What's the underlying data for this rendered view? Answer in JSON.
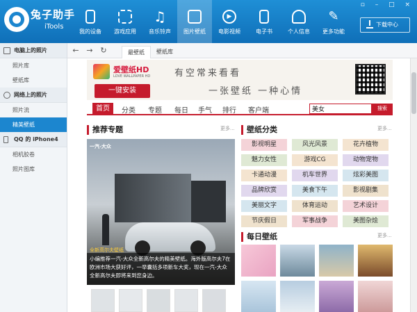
{
  "app": {
    "title_cn": "兔子助手",
    "title_en": "iTools"
  },
  "window_controls": "▫ – □ ×",
  "nav": [
    {
      "label": "我的设备",
      "icon": "phone-icon"
    },
    {
      "label": "游戏应用",
      "icon": "apps-icon"
    },
    {
      "label": "音乐铃声",
      "icon": "music-icon"
    },
    {
      "label": "图片壁纸",
      "icon": "image-icon",
      "active": true
    },
    {
      "label": "电影视频",
      "icon": "video-icon"
    },
    {
      "label": "电子书",
      "icon": "book-icon"
    },
    {
      "label": "个人信息",
      "icon": "person-icon"
    },
    {
      "label": "更多功能",
      "icon": "tools-icon"
    }
  ],
  "download_button": "下载中心",
  "sidebar": {
    "sections": [
      {
        "title": "电脑上的照片",
        "items": [
          "照片库",
          "壁纸库"
        ]
      },
      {
        "title": "网络上的照片",
        "items": [
          "照片流",
          "精美壁纸"
        ]
      },
      {
        "title": "QQ 的 iPhone4",
        "items": [
          "相机胶卷",
          "照片图库"
        ]
      }
    ],
    "active_item": "精美壁纸"
  },
  "browser": {
    "back": "←",
    "forward": "→",
    "refresh": "↻",
    "tabs": [
      "最壁纸",
      "壁纸库"
    ]
  },
  "banner": {
    "app_name": "爱壁纸HD",
    "app_sub": "LOVE WALLPAPER HD",
    "install": "一键安装",
    "slogan1": "有空常来看看",
    "slogan2": "一张壁纸 一种心情"
  },
  "catnav": {
    "items": [
      "首页",
      "分类",
      "专题",
      "每日",
      "手气",
      "排行",
      "客户端"
    ],
    "search_value": "美女",
    "search_button": "搜索"
  },
  "featured": {
    "title": "推荐专题",
    "more": "更多...",
    "brand": "一汽-大众",
    "tag": "全新高尔夫壁纸",
    "desc": "小编推荐一汽-大众全新高尔夫的精美壁纸。海外版高尔夫7在欧洲市场大获好评，一举囊括多项新车大奖，现在一汽-大众全新高尔夫即将来到您身边。"
  },
  "categories": {
    "title": "壁纸分类",
    "more": "更多...",
    "tags": [
      "影视明星",
      "风光风景",
      "花卉植物",
      "魅力女性",
      "游戏CG",
      "动物宠物",
      "卡通动漫",
      "机车世界",
      "炫彩美图",
      "品牌欣赏",
      "美食下午",
      "影视剧集",
      "美丽文字",
      "体育运动",
      "艺术设计",
      "节庆假日",
      "军事战争",
      "美图杂烩"
    ],
    "tag_colors": [
      "#f4d3d8",
      "#dfe9d4",
      "#f4e4d0",
      "#e1d8ee",
      "#d5e6ef",
      "#efe2cd"
    ]
  },
  "daily": {
    "title": "每日壁纸",
    "more": "更多..."
  },
  "colors": {
    "brand_blue": "#1c86cf",
    "accent_red": "#c51b2c"
  }
}
